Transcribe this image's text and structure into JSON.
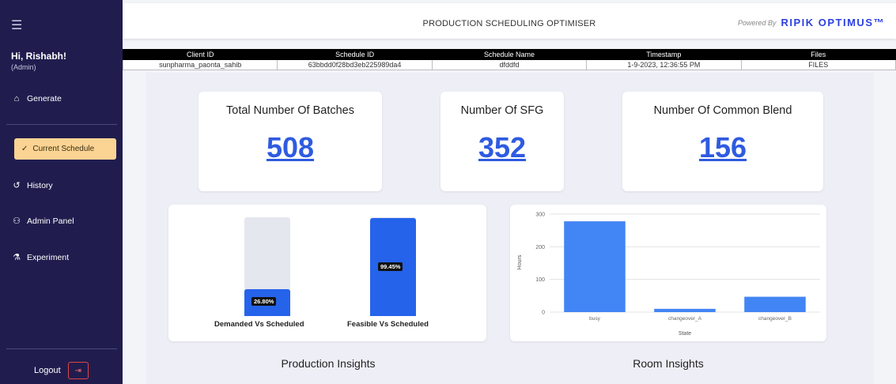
{
  "sidebar": {
    "greeting": "Hi, Rishabh!",
    "role": "(Admin)",
    "items": [
      {
        "label": "Generate",
        "icon": "home-icon"
      },
      {
        "label": "Current Schedule",
        "icon": "check-icon",
        "active": true
      },
      {
        "label": "History",
        "icon": "history-icon"
      },
      {
        "label": "Admin Panel",
        "icon": "user-icon"
      },
      {
        "label": "Experiment",
        "icon": "flask-icon"
      }
    ],
    "logout_label": "Logout"
  },
  "header": {
    "title": "PRODUCTION SCHEDULING OPTIMISER",
    "powered_by": "Powered By",
    "brand": "RIPIK OPTIMUS™"
  },
  "info_table": {
    "columns": [
      "Client ID",
      "Schedule ID",
      "Schedule Name",
      "Timestamp",
      "Files"
    ],
    "row": [
      "sunpharma_paonta_sahib",
      "63bbdd0f28bd3eb225989da4",
      "dfddfd",
      "1-9-2023, 12:36:55 PM",
      "FILES"
    ]
  },
  "stats": [
    {
      "title": "Total Number Of Batches",
      "value": "508"
    },
    {
      "title": "Number Of SFG",
      "value": "352"
    },
    {
      "title": "Number Of Common Blend",
      "value": "156"
    }
  ],
  "progress_bars": [
    {
      "label": "Demanded Vs Scheduled",
      "percent_text": "26.80%",
      "fraction": 0.268
    },
    {
      "label": "Feasible Vs Scheduled",
      "percent_text": "99.45%",
      "fraction": 0.9945
    }
  ],
  "sections": {
    "production": "Production Insights",
    "room": "Room Insights"
  },
  "colors": {
    "sidebar_bg": "#201d4e",
    "active_nav": "#fbd393",
    "accent_blue": "#2f5be0",
    "bar_blue": "#4285f4",
    "logout_red": "#e0434a"
  },
  "chart_data": {
    "type": "bar",
    "categories": [
      "busy",
      "changeover_A",
      "changeover_B"
    ],
    "values": [
      278,
      10,
      47
    ],
    "xlabel": "State",
    "ylabel": "Hours",
    "ylim": [
      0,
      300
    ],
    "yticks": [
      0,
      100,
      200,
      300
    ],
    "grid": true
  }
}
